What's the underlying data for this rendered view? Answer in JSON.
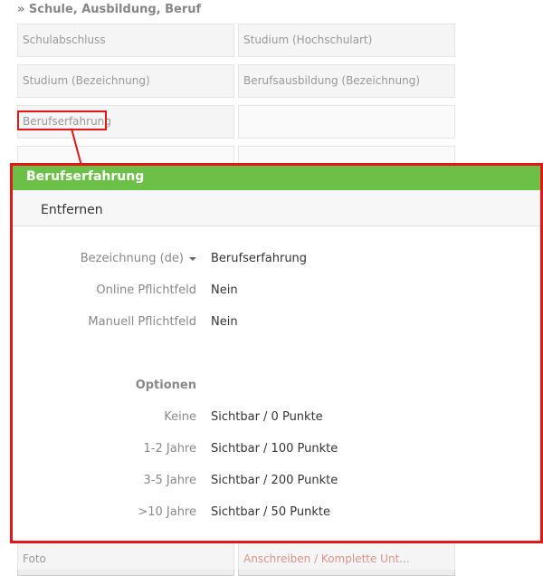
{
  "section": {
    "title": "» Schule, Ausbildung, Beruf"
  },
  "grid": {
    "row1": [
      "Schulabschluss",
      "Studium (Hochschulart)"
    ],
    "row2": [
      "Studium (Bezeichnung)",
      "Berufsausbildung (Bezeichnung)"
    ],
    "row3": [
      "Berufserfahrung",
      ""
    ],
    "row4": [
      "",
      ""
    ],
    "bottom": [
      "Foto",
      "Anschreiben / Komplette Unt..."
    ]
  },
  "panel": {
    "title": "Berufserfahrung",
    "remove_label": "Entfernen",
    "fields": [
      {
        "label": "Bezeichnung (de)",
        "value": "Berufserfahrung"
      },
      {
        "label": "Online Pflichtfeld",
        "value": "Nein"
      },
      {
        "label": "Manuell Pflichtfeld",
        "value": "Nein"
      }
    ],
    "options_label": "Optionen",
    "options": [
      {
        "label": "Keine",
        "value": "Sichtbar / 0 Punkte"
      },
      {
        "label": "1-2 Jahre",
        "value": "Sichtbar / 100 Punkte"
      },
      {
        "label": "3-5 Jahre",
        "value": "Sichtbar / 200 Punkte"
      },
      {
        "label": ">10 Jahre",
        "value": "Sichtbar / 50 Punkte"
      }
    ]
  },
  "colors": {
    "header_green": "#6cbf47",
    "highlight_red": "#e01818",
    "link_red": "#c0392b"
  }
}
